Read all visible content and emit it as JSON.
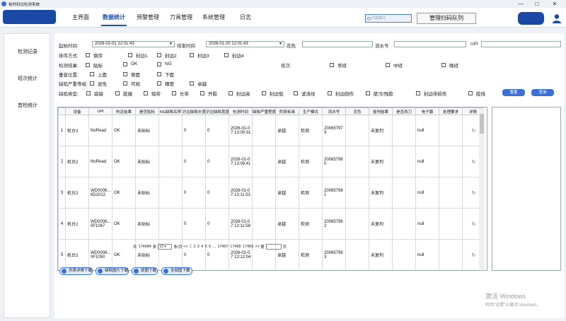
{
  "app": {
    "title": "板材封边检测系统"
  },
  "window": {
    "minimize": "—",
    "maximize": "☐",
    "close": "✕"
  },
  "nav": {
    "tabs": [
      "主界面",
      "数据统计",
      "预警管理",
      "刀具管理",
      "系统管理",
      "日志"
    ],
    "active": 1,
    "scan_placeholder": "扫描模式",
    "scan_queue_label": "管理扫码队列"
  },
  "sidebar": {
    "items": [
      "检测记录",
      "班次统计",
      "首检统计"
    ]
  },
  "filters": {
    "start_label": "起始时间:",
    "start_value": "2026-01-01 12:01:43",
    "end_label": "结束时间",
    "end_value": "2026-01-20 12:01:43",
    "color_label": "花色",
    "serial_label": "流水号",
    "upi_label": "UPI",
    "sort_label": "排序方式:",
    "sort_options": [
      "倒序",
      "封边1",
      "封边2",
      "封边3",
      "封边4"
    ],
    "result_label": "检测结果:",
    "result_options": [
      "贴标",
      "OK",
      "NG"
    ],
    "shift_label": "班次:",
    "shift_options": [
      "早班",
      "中班",
      "晚班"
    ],
    "vertical_label": "垂直位置:",
    "vertical_options": [
      "上面",
      "侧面",
      "下面"
    ],
    "severity_label": "缺陷严重等级:",
    "severity_options": [
      "显性",
      "可视",
      "精度",
      "卓越"
    ],
    "defect_label": "缺陷类型:",
    "defect_options": [
      "崩缺",
      "胶缝",
      "短带",
      "长带",
      "开胶",
      "封边高",
      "封边低",
      "波浪纹",
      "封边刮伤",
      "脏污/残胶",
      "封边带损伤",
      "胶线"
    ],
    "reset_label": "重置",
    "query_label": "查询"
  },
  "table": {
    "columns": [
      "",
      "设备",
      "UPI",
      "判定结果",
      "是否贴标",
      "NG缺陷名称",
      "识边缺陷长度",
      "识边缺陷宽度",
      "检测时间",
      "缺陷严重程度",
      "阶段标准",
      "生产模式",
      "流水号",
      "花色",
      "复判结果",
      "是否改刀",
      "电子膜",
      "处理要求",
      "详情"
    ],
    "rows": [
      {
        "idx": "1",
        "device": "机台2",
        "upi": "NoRead",
        "judge": "OK",
        "label": "未贴标",
        "ng": "",
        "len": "0",
        "wid": "0",
        "time": "2026-01-07 13:09:31",
        "sev": "",
        "stage": "卓越",
        "mode": "检测",
        "serial": "200657979",
        "color": "",
        "review": "未复判",
        "recut": "",
        "film": "null",
        "req": "",
        "detail": "↻"
      },
      {
        "idx": "2",
        "device": "机台2",
        "upi": "NoRead",
        "judge": "OK",
        "label": "未贴标",
        "ng": "",
        "len": "0",
        "wid": "0",
        "time": "2026-01-07 13:09:41",
        "sev": "",
        "stage": "卓越",
        "mode": "检测",
        "serial": "200657980",
        "color": "",
        "review": "未复判",
        "recut": "",
        "film": "null",
        "req": "",
        "detail": "↻"
      },
      {
        "idx": "3",
        "device": "机台2",
        "upi": "WD0006... 6D1012",
        "judge": "OK",
        "label": "未贴标",
        "ng": "",
        "len": "0",
        "wid": "0",
        "time": "2026-01-07 13:11:53",
        "sev": "",
        "stage": "卓越",
        "mode": "检测",
        "serial": "200657981",
        "color": "",
        "review": "未复判",
        "recut": "",
        "film": "null",
        "req": "",
        "detail": "↻"
      },
      {
        "idx": "4",
        "device": "机台2",
        "upi": "WD0006... 0F1047",
        "judge": "OK",
        "label": "未贴标",
        "ng": "",
        "len": "0",
        "wid": "0",
        "time": "2026-01-07 13:11:58",
        "sev": "",
        "stage": "卓越",
        "mode": "检测",
        "serial": "200657982",
        "color": "",
        "review": "未复判",
        "recut": "",
        "film": "null",
        "req": "",
        "detail": "↻"
      },
      {
        "idx": "5",
        "device": "机台2",
        "upi": "WD0006... 0F1050",
        "judge": "OK",
        "label": "未贴标",
        "ng": "",
        "len": "0",
        "wid": "0",
        "time": "2026-01-07 13:12:04",
        "sev": "",
        "stage": "卓越",
        "mode": "检测",
        "serial": "200657983",
        "color": "",
        "review": "未复判",
        "recut": "",
        "film": "null",
        "req": "",
        "detail": "↻"
      }
    ]
  },
  "pager": {
    "total_prefix": "共",
    "total": "174684",
    "total_suffix": "条",
    "page_size": "10",
    "page_size_suffix": "条/页",
    "prev": "<<",
    "pages": [
      "1",
      "2",
      "3",
      "4",
      "5",
      "6"
    ],
    "ellipsis": "...",
    "tail_pages": [
      "17467",
      "17468",
      "17469"
    ],
    "next": ">>",
    "jump_prefix": "第",
    "jump_suffix": "页"
  },
  "downloads": [
    "列表详情下载",
    "缺陷图片下载",
    "原图下载",
    "全部图下载"
  ],
  "watermark": {
    "line1": "激活 Windows",
    "line2": "转到\"设置\"以激活 Windows。"
  }
}
